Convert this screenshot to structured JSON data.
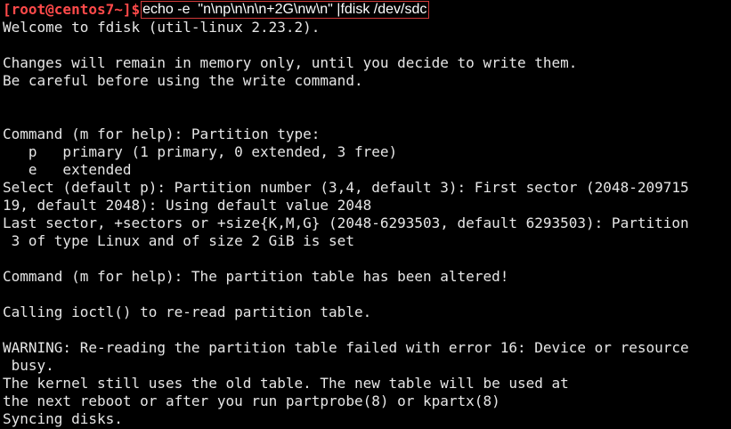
{
  "terminal": {
    "prompt": "[root@centos7~]$",
    "command": "echo -e  \"n\\np\\n\\n\\n+2G\\nw\\n\" |fdisk /dev/sdc",
    "lines": [
      "Welcome to fdisk (util-linux 2.23.2).",
      "",
      "Changes will remain in memory only, until you decide to write them.",
      "Be careful before using the write command.",
      "",
      "",
      "Command (m for help): Partition type:",
      "   p   primary (1 primary, 0 extended, 3 free)",
      "   e   extended",
      "Select (default p): Partition number (3,4, default 3): First sector (2048-209715",
      "19, default 2048): Using default value 2048",
      "Last sector, +sectors or +size{K,M,G} (2048-6293503, default 6293503): Partition",
      " 3 of type Linux and of size 2 GiB is set",
      "",
      "Command (m for help): The partition table has been altered!",
      "",
      "Calling ioctl() to re-read partition table.",
      "",
      "WARNING: Re-reading the partition table failed with error 16: Device or resource",
      " busy.",
      "The kernel still uses the old table. The new table will be used at",
      "the next reboot or after you run partprobe(8) or kpartx(8)",
      "Syncing disks."
    ],
    "colors": {
      "background": "#000000",
      "text": "#e6e6e6",
      "prompt": "#ff4a4a",
      "highlight_border": "#d23a3a"
    }
  }
}
